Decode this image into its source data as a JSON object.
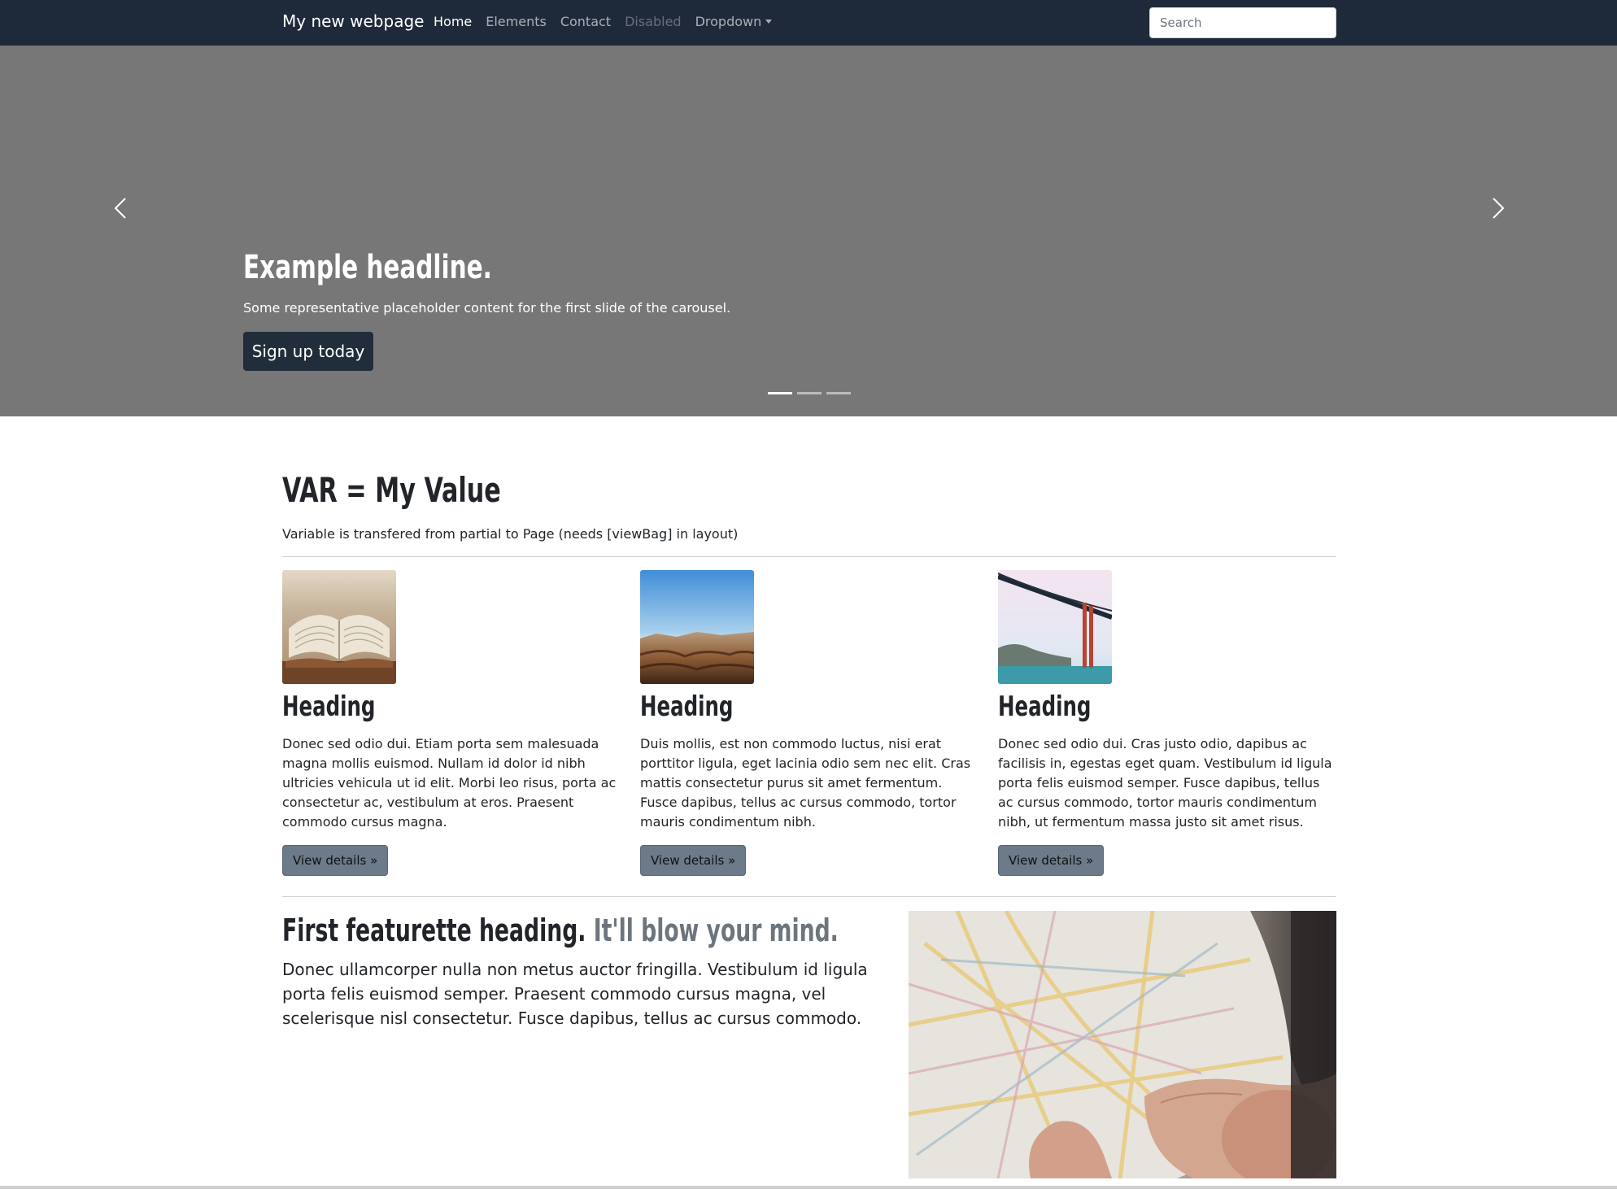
{
  "navbar": {
    "brand": "My new webpage",
    "items": [
      {
        "label": "Home",
        "state": "active"
      },
      {
        "label": "Elements",
        "state": "normal"
      },
      {
        "label": "Contact",
        "state": "normal"
      },
      {
        "label": "Disabled",
        "state": "disabled"
      },
      {
        "label": "Dropdown",
        "state": "dropdown"
      }
    ],
    "search_placeholder": "Search"
  },
  "carousel": {
    "headline": "Example headline.",
    "text": "Some representative placeholder content for the first slide of the carousel.",
    "button": "Sign up today",
    "active_slide": 1,
    "slide_count": 3
  },
  "var_section": {
    "title": "VAR = My Value",
    "subtitle": "Variable is transfered from partial to Page (needs [viewBag] in layout)"
  },
  "columns": [
    {
      "heading": "Heading",
      "text": "Donec sed odio dui. Etiam porta sem malesuada magna mollis euismod. Nullam id dolor id nibh ultricies vehicula ut id elit. Morbi leo risus, porta ac consectetur ac, vestibulum at eros. Praesent commodo cursus magna.",
      "button": "View details »",
      "image": "open-book-photo"
    },
    {
      "heading": "Heading",
      "text": "Duis mollis, est non commodo luctus, nisi erat porttitor ligula, eget lacinia odio sem nec elit. Cras mattis consectetur purus sit amet fermentum. Fusce dapibus, tellus ac cursus commodo, tortor mauris condimentum nibh.",
      "button": "View details »",
      "image": "desert-landscape-photo"
    },
    {
      "heading": "Heading",
      "text": "Donec sed odio dui. Cras justo odio, dapibus ac facilisis in, egestas eget quam. Vestibulum id ligula porta felis euismod semper. Fusce dapibus, tellus ac cursus commodo, tortor mauris condimentum nibh, ut fermentum massa justo sit amet risus.",
      "button": "View details »",
      "image": "golden-gate-bridge-photo"
    }
  ],
  "featurette": {
    "heading": "First featurette heading.",
    "heading_muted": "It'll blow your mind.",
    "text": "Donec ullamcorper nulla non metus auctor fringilla. Vestibulum id ligula porta felis euismod semper. Praesent commodo cursus magna, vel scelerisque nisl consectetur. Fusce dapibus, tellus ac cursus commodo.",
    "image": "hand-holding-map-photo"
  },
  "colors": {
    "navbar_bg": "#1e2a3a",
    "carousel_bg": "#777777",
    "button_dark": "#212d3b",
    "button_secondary": "#6c7a89"
  }
}
